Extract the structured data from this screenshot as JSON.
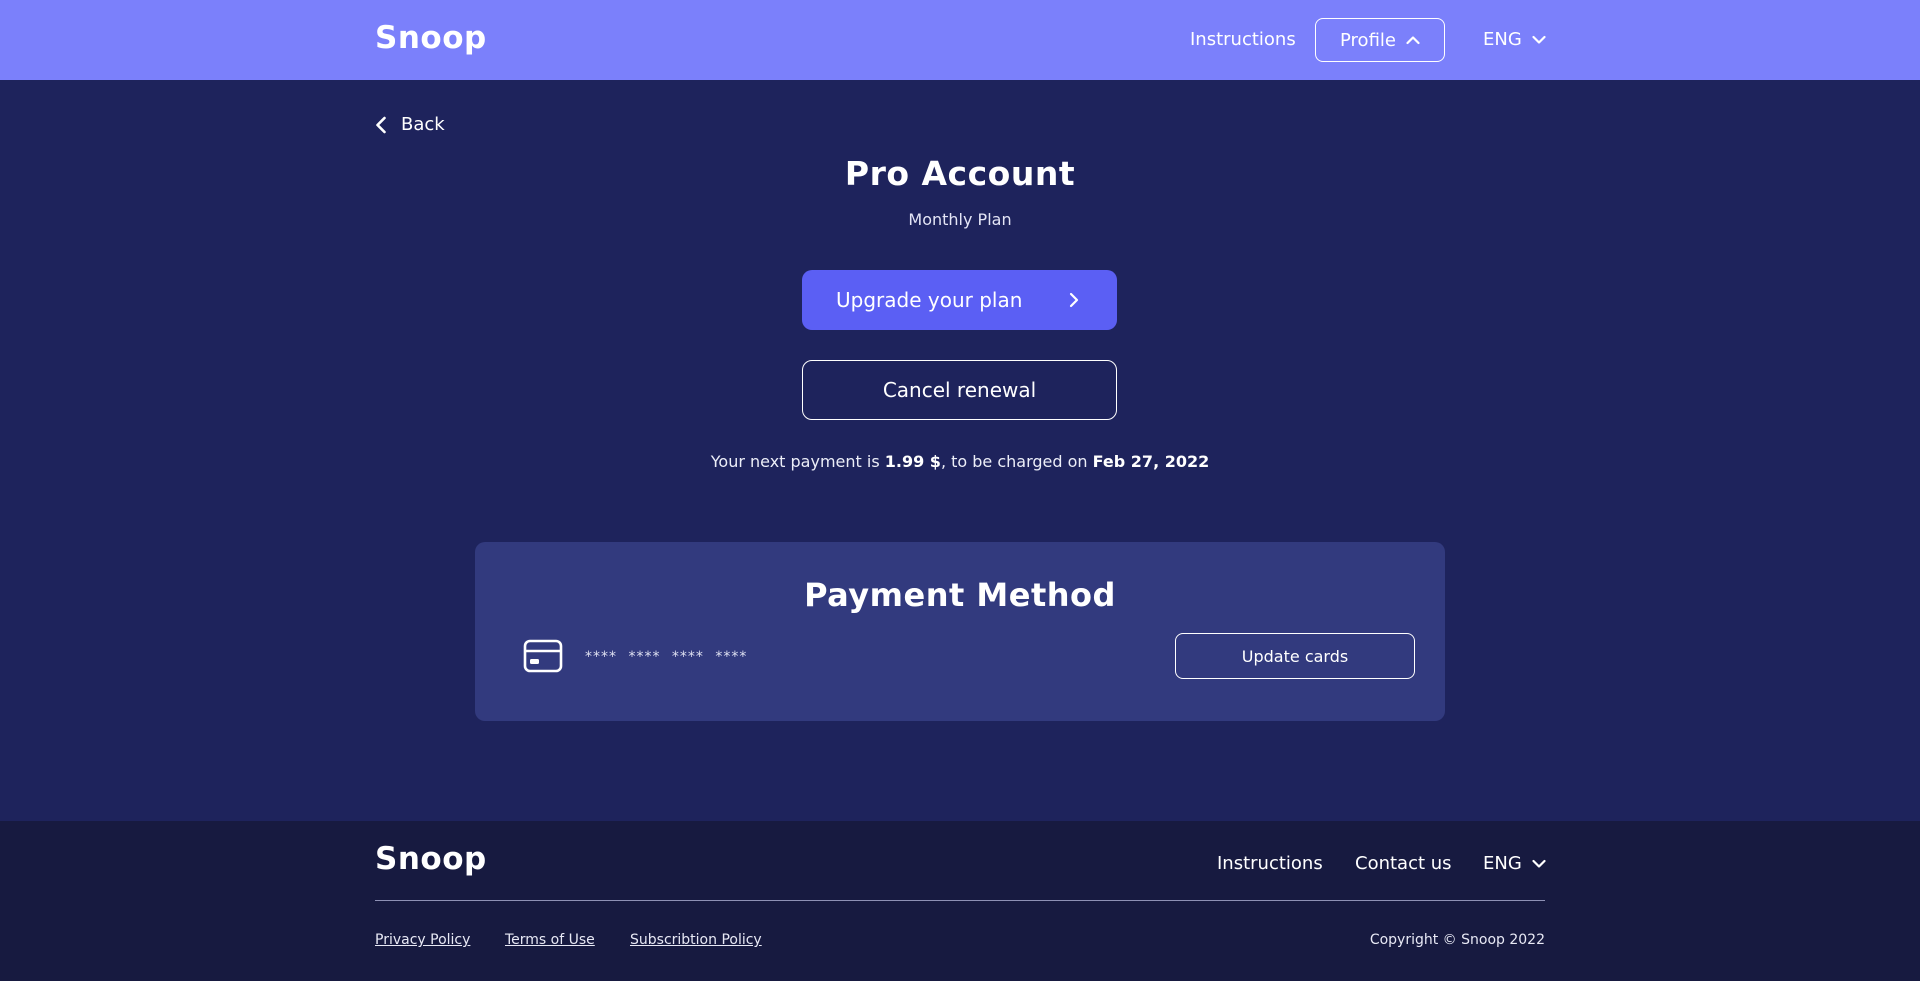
{
  "header": {
    "logo": "Snoop",
    "instructions": "Instructions",
    "profile": "Profile",
    "language": "ENG"
  },
  "back": "Back",
  "account": {
    "title": "Pro Account",
    "plan": "Monthly Plan",
    "upgrade_label": "Upgrade your plan",
    "cancel_label": "Cancel renewal"
  },
  "payment_note": {
    "prefix": "Your next payment is ",
    "amount": "1.99 $",
    "middle": ", to be charged on ",
    "date": "Feb 27, 2022"
  },
  "payment_method": {
    "title": "Payment Method",
    "card_number": "**** **** **** ****",
    "update_label": "Update cards"
  },
  "footer": {
    "logo": "Snoop",
    "instructions": "Instructions",
    "contact": "Contact us",
    "language": "ENG",
    "privacy": "Privacy Policy",
    "terms": "Terms of Use",
    "subscription": "Subscribtion Policy",
    "copyright": "Copyright © Snoop 2022"
  },
  "colors": {
    "header_bg": "#7b80fb",
    "page_bg": "#1e235c",
    "primary_button": "#5b5ff4",
    "card_bg": "#323a7e",
    "footer_bg": "#171a40"
  }
}
